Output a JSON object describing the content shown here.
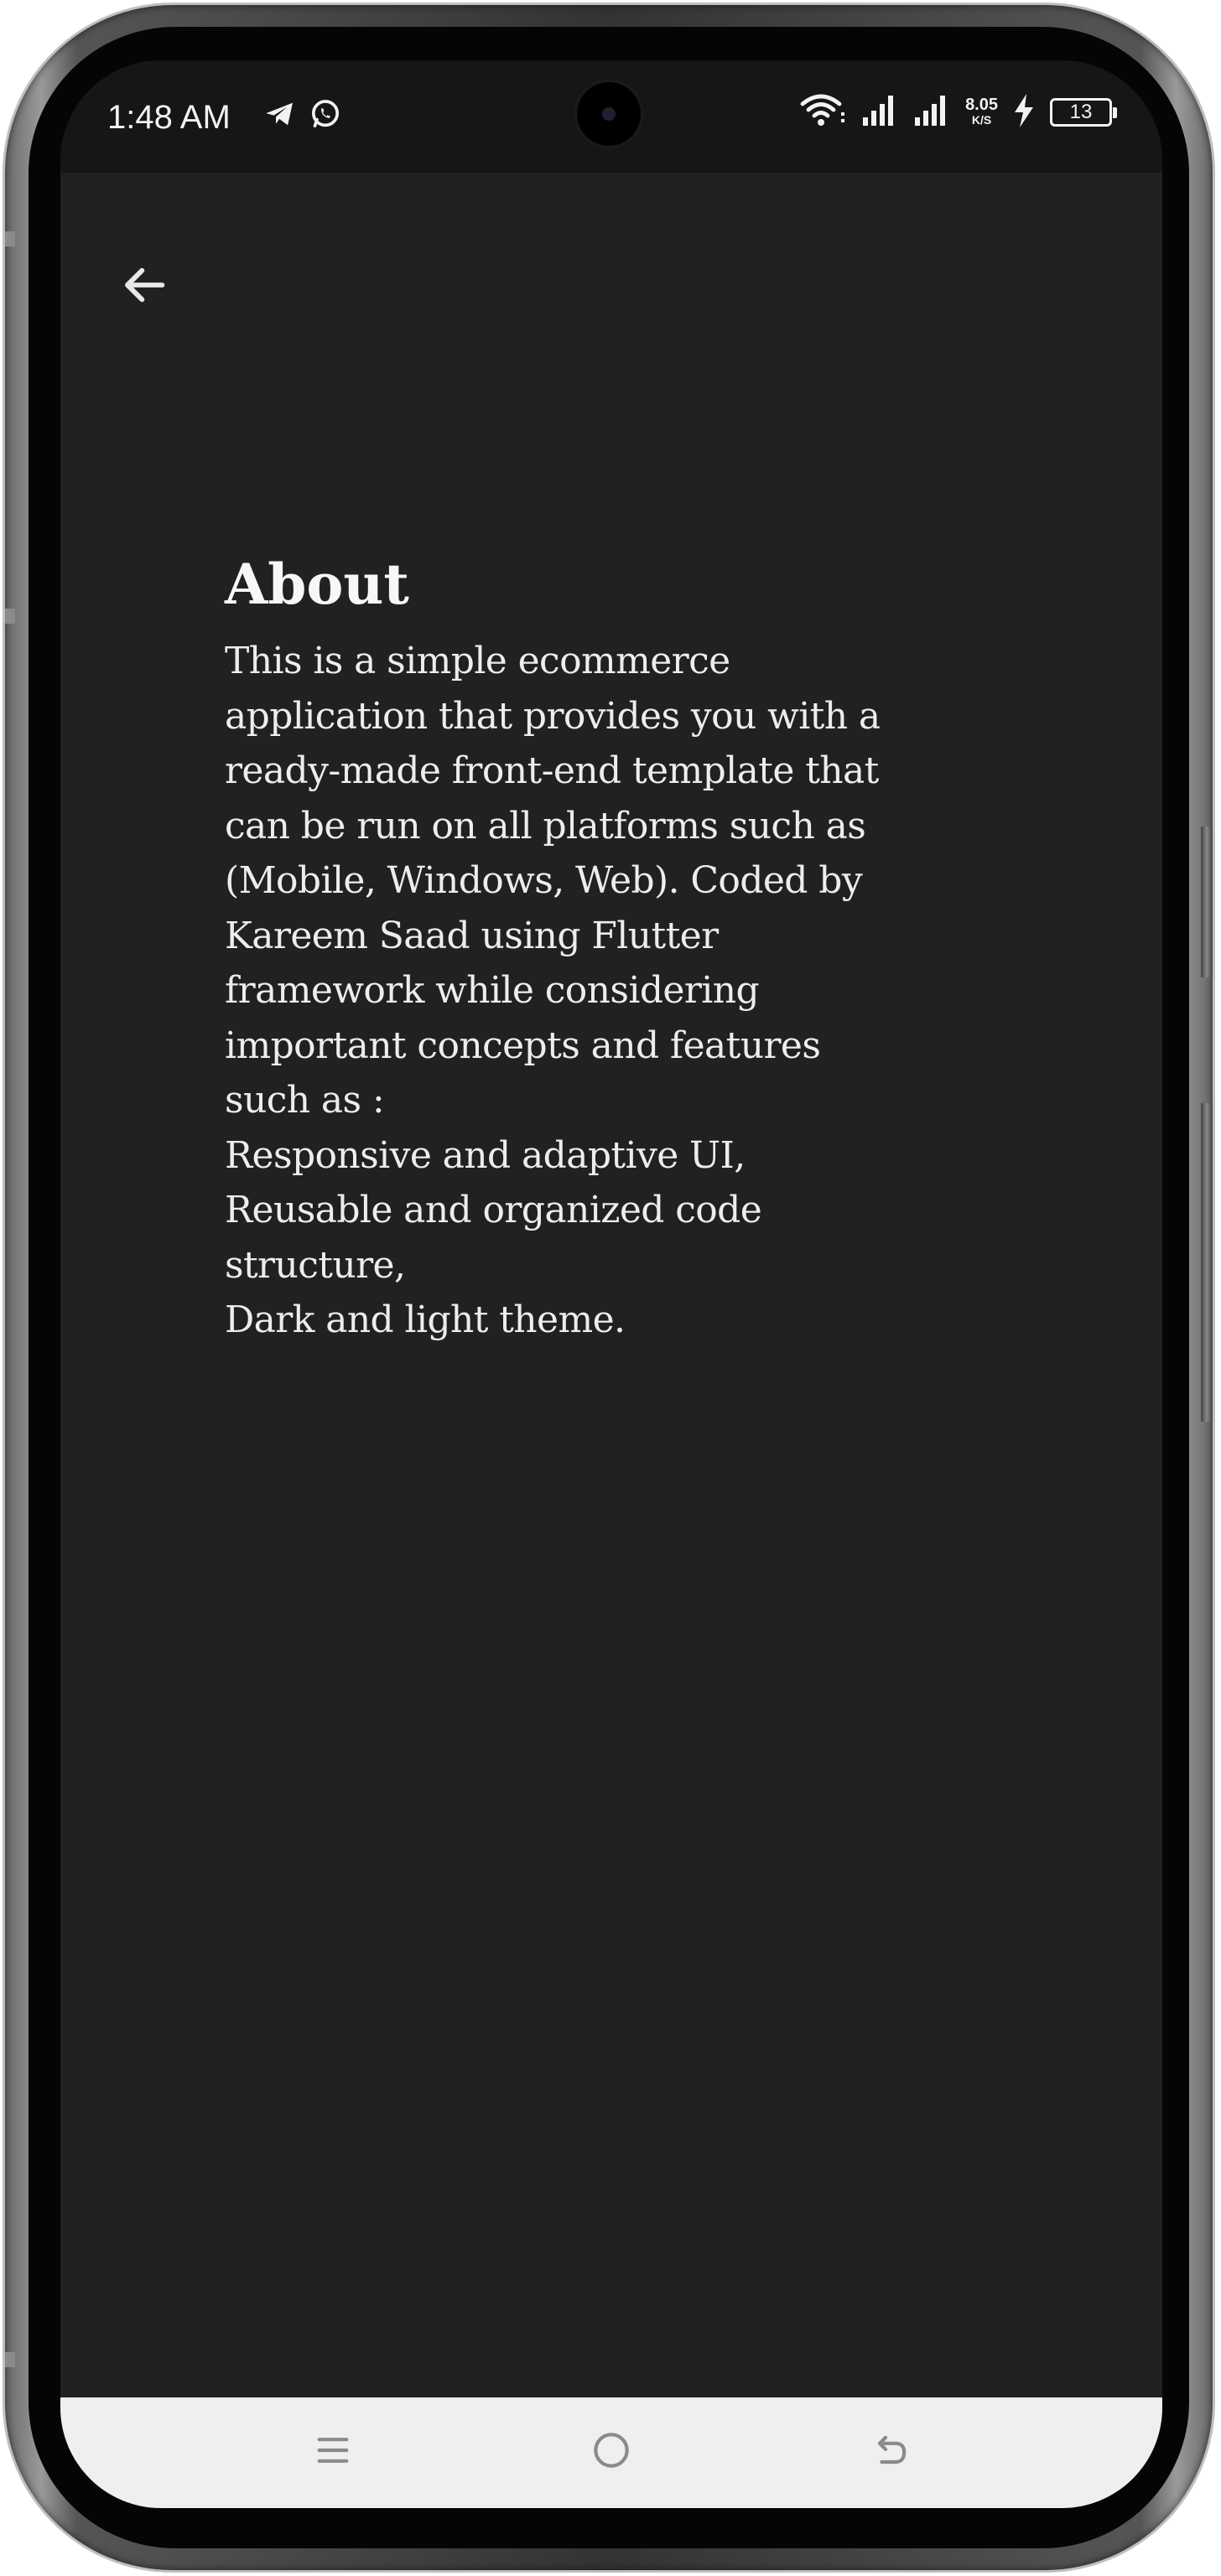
{
  "status_bar": {
    "time": "1:48 AM",
    "net_speed_value": "8.05",
    "net_speed_unit": "K/S",
    "battery_level": "13",
    "icons": [
      "telegram-icon",
      "whatsapp-icon",
      "wifi-icon",
      "signal-icon",
      "signal-icon",
      "charging-icon",
      "battery-icon"
    ]
  },
  "app_bar": {
    "back_icon": "arrow-left-icon"
  },
  "page": {
    "title": "About",
    "body_lines": [
      "This is a simple ecommerce",
      "application that provides you with a",
      "ready-made front-end template that",
      "can be run on all platforms such as",
      "(Mobile, Windows, Web). Coded by",
      "Kareem Saad using Flutter",
      "framework while considering",
      "important concepts and features",
      "such as :",
      "Responsive and adaptive UI,",
      "Reusable and organized code",
      "structure,",
      "Dark and light theme."
    ]
  },
  "nav_bar": {
    "icons": [
      "menu-icon",
      "home-circle-icon",
      "back-return-icon"
    ]
  },
  "colors": {
    "background": "#212121",
    "status_bar": "#161616",
    "text": "#ededed",
    "nav_bar": "#efefef",
    "nav_icon": "#8a8a8a"
  }
}
